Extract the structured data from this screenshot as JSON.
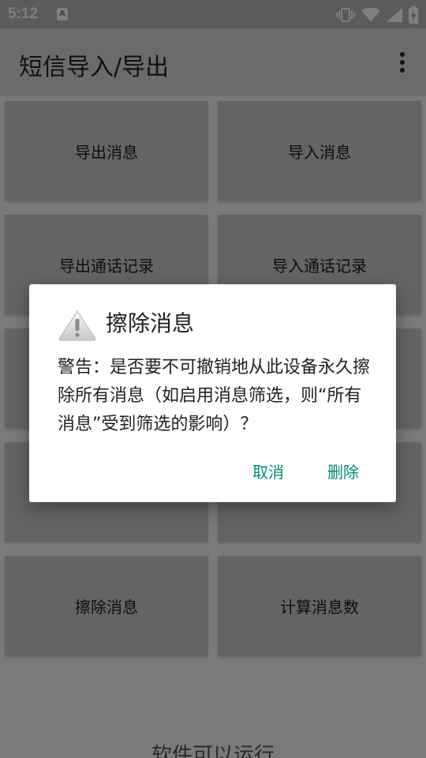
{
  "status_bar": {
    "time": "5:12",
    "notification_badge": "A",
    "icons": [
      "vibrate-icon",
      "wifi-icon",
      "signal-icon",
      "battery-icon"
    ]
  },
  "app_bar": {
    "title": "短信导入/导出",
    "menu_icon": "more-vert-icon"
  },
  "grid": {
    "export_messages": "导出消息",
    "import_messages": "导入消息",
    "export_call_log": "导出通话记录",
    "import_call_log": "导入通话记录",
    "erase_messages": "擦除消息",
    "count_messages": "计算消息数"
  },
  "footer_text": "软件可以运行",
  "dialog": {
    "title": "擦除消息",
    "icon": "warning-icon",
    "message": "警告：是否要不可撤销地从此设备永久擦除所有消息（如启用消息筛选，则“所有消息”受到筛选的影响）？",
    "cancel_label": "取消",
    "delete_label": "删除"
  },
  "colors": {
    "accent": "#00897b",
    "scrim": "rgba(0,0,0,0.5)"
  }
}
